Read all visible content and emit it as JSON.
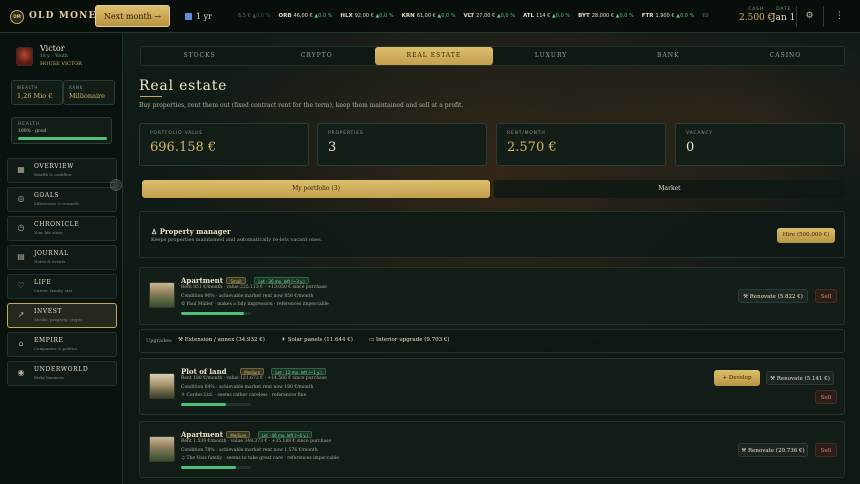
{
  "brand": {
    "logo_initials": "OM",
    "name": "OLD MONEY"
  },
  "topbar": {
    "next_label": "Next month →",
    "year_label": "1 yr",
    "tickers": [
      {
        "sym": "",
        "price": "6,5 €",
        "chg": "▲0,0 %",
        "dim": true
      },
      {
        "sym": "ORB",
        "price": "46,00 €",
        "chg": "▲0,0 %",
        "dim": false
      },
      {
        "sym": "HLX",
        "price": "92,00 €",
        "chg": "▲0,0 %",
        "dim": false
      },
      {
        "sym": "KRN",
        "price": "61,00 €",
        "chg": "▲0,0 %",
        "dim": false
      },
      {
        "sym": "VLT",
        "price": "27,00 €",
        "chg": "▲0,0 %",
        "dim": false
      },
      {
        "sym": "ATL",
        "price": "114 €",
        "chg": "▲0,0 %",
        "dim": false
      },
      {
        "sym": "BYT",
        "price": "28.000 €",
        "chg": "▲0,0 %",
        "dim": false
      },
      {
        "sym": "FTR",
        "price": "1.900 €",
        "chg": "▲0,0 %",
        "dim": false
      },
      {
        "sym": "",
        "price": "€0",
        "chg": "",
        "dim": true
      }
    ],
    "cash_label": "CASH",
    "cash_value": "2.500 €",
    "date_label": "DATE",
    "date_value": "Jan 1",
    "settings_icon": "gear-icon",
    "menu_icon": "more-icon"
  },
  "player": {
    "name": "Victor",
    "sub": "18 y. · Youth",
    "house": "HOUSE VICTOR",
    "wealth_label": "WEALTH",
    "wealth_value": "1,26 Mio €",
    "rank_label": "RANK",
    "rank_value": "Millionaire",
    "health_label": "HEALTH",
    "health_value": "100% · good",
    "health_fraction": 1.0
  },
  "nav": [
    {
      "key": "overview",
      "label": "OVERVIEW",
      "sub": "Wealth & cashflow",
      "icon": "grid-icon",
      "glyph": "▦",
      "active": false
    },
    {
      "key": "goals",
      "label": "GOALS",
      "sub": "Milestones & rewards",
      "icon": "target-icon",
      "glyph": "◎",
      "active": false
    },
    {
      "key": "chronicle",
      "label": "CHRONICLE",
      "sub": "Your life story",
      "icon": "clock-icon",
      "glyph": "◷",
      "active": false
    },
    {
      "key": "journal",
      "label": "JOURNAL",
      "sub": "Notes & events",
      "icon": "document-icon",
      "glyph": "▤",
      "active": false
    },
    {
      "key": "life",
      "label": "LIFE",
      "sub": "Career, family, stat",
      "icon": "heart-icon",
      "glyph": "♡",
      "active": false
    },
    {
      "key": "invest",
      "label": "INVEST",
      "sub": "Stocks, property, crypto",
      "icon": "trend-icon",
      "glyph": "↗",
      "active": true
    },
    {
      "key": "empire",
      "label": "EMPIRE",
      "sub": "Companies & politics",
      "icon": "bank-icon",
      "glyph": "⌂",
      "active": false
    },
    {
      "key": "underworld",
      "label": "UNDERWORLD",
      "sub": "Risky business",
      "icon": "eye-icon",
      "glyph": "◉",
      "active": false
    }
  ],
  "tabs": [
    "STOCKS",
    "CRYPTO",
    "REAL ESTATE",
    "LUXURY",
    "BANK",
    "CASINO"
  ],
  "active_tab": "REAL ESTATE",
  "page": {
    "title": "Real estate",
    "desc": "Buy properties, rent them out (fixed contract rent for the term), keep them maintained and sell at a profit."
  },
  "kpis": [
    {
      "label": "PORTFOLIO VALUE",
      "value": "696.158 €",
      "color": "#d7b461"
    },
    {
      "label": "PROPERTIES",
      "value": "3",
      "color": "#ece3c9"
    },
    {
      "label": "RENT/MONTH",
      "value": "2.570 €",
      "color": "#d7b461"
    },
    {
      "label": "VACANCY",
      "value": "0",
      "color": "#ece3c9"
    }
  ],
  "subtabs": {
    "portfolio": "My portfolio (3)",
    "market": "Market"
  },
  "manager": {
    "icon": "manager-icon",
    "title": "Property manager",
    "desc": "Keeps properties maintained and automatically re-lets vacant ones.",
    "hire_label": "Hire (500.000 €)"
  },
  "properties": [
    {
      "title": "Apartment",
      "size": "Small",
      "lease": "Let · 36 mo. left (~3 y.)",
      "line1": "Rent 851 €/month · value 225.113 € · +13.050 € since purchase",
      "line2": "Condition 90% · achievable market rent now 858 €/month",
      "line3": "☺ Paul Müller · makes a tidy impression · references impeccable",
      "condition": 0.9,
      "renovate": "Renovate (5.822 €)",
      "sell": "Sell",
      "develop": ""
    },
    {
      "title": "Plot of land",
      "size": "Medium",
      "lease": "Let · 12 mo. left (~1 y.)",
      "line1": "Rent 180 €/month · value 121.672 € · +14.566 € since purchase",
      "line2": "Condition 64% · achievable market rent now 180 €/month",
      "line3": "⚘ Cordes Ltd. · seems rather careless · references fine",
      "condition": 0.64,
      "renovate": "Renovate (5.141 €)",
      "sell": "Sell",
      "develop": "+ Develop"
    },
    {
      "title": "Apartment",
      "size": "Medium",
      "lease": "Let · 48 mo. left (~4 y.)",
      "line1": "Rent 1.539 €/month · value 349.373 € · +35.188 € since purchase",
      "line2": "Condition 78% · achievable market rent now 1.576 €/month",
      "line3": "♫ The Voss family · seems to take great care · references impeccable",
      "condition": 0.78,
      "renovate": "Renovate (20.736 €)",
      "sell": "Sell",
      "develop": ""
    }
  ],
  "upgrades": {
    "label": "Upgrades:",
    "items": [
      "Extension / annex (34.932 €)",
      "Solar panels (11.644 €)",
      "Interior upgrade (9.703 €)"
    ]
  }
}
